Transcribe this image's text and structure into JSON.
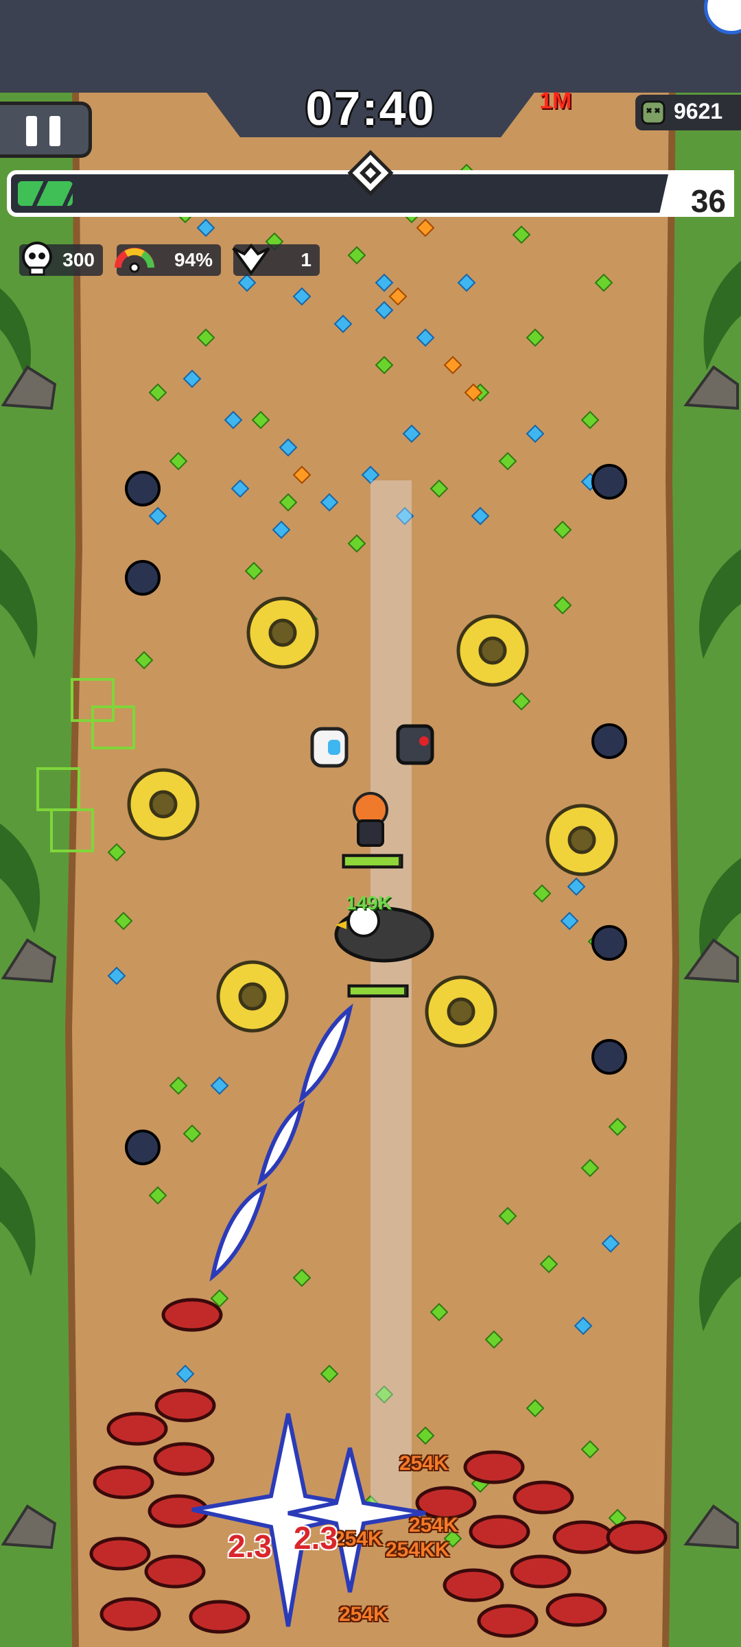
{
  "hud": {
    "timer": "07:40",
    "kill_count": "9621",
    "level": "36",
    "xp_progress": 0.08,
    "boss_warning": "1M"
  },
  "stats": [
    {
      "name": "skull",
      "value": "300"
    },
    {
      "name": "gauge",
      "value": "94%"
    },
    {
      "name": "wings",
      "value": "1"
    }
  ],
  "combat_text": {
    "player_hp_text": "149K",
    "hits": [
      "254K",
      "254K",
      "254K",
      "254KK",
      "254K"
    ],
    "crits": [
      "2.3",
      "2.3"
    ]
  },
  "colors": {
    "ground": "#c9965e",
    "jungle": "#5b9a3a",
    "xp_green": "#3fbf56",
    "gem_green": "#6ad42c",
    "gem_blue": "#3fb6ef",
    "enemy_red": "#c22a2a",
    "hud_dark": "#3b4150"
  },
  "icons": [
    "pause-icon",
    "skull-icon",
    "gauge-icon",
    "wings-icon",
    "level-badge-icon",
    "kill-zombie-icon"
  ]
}
